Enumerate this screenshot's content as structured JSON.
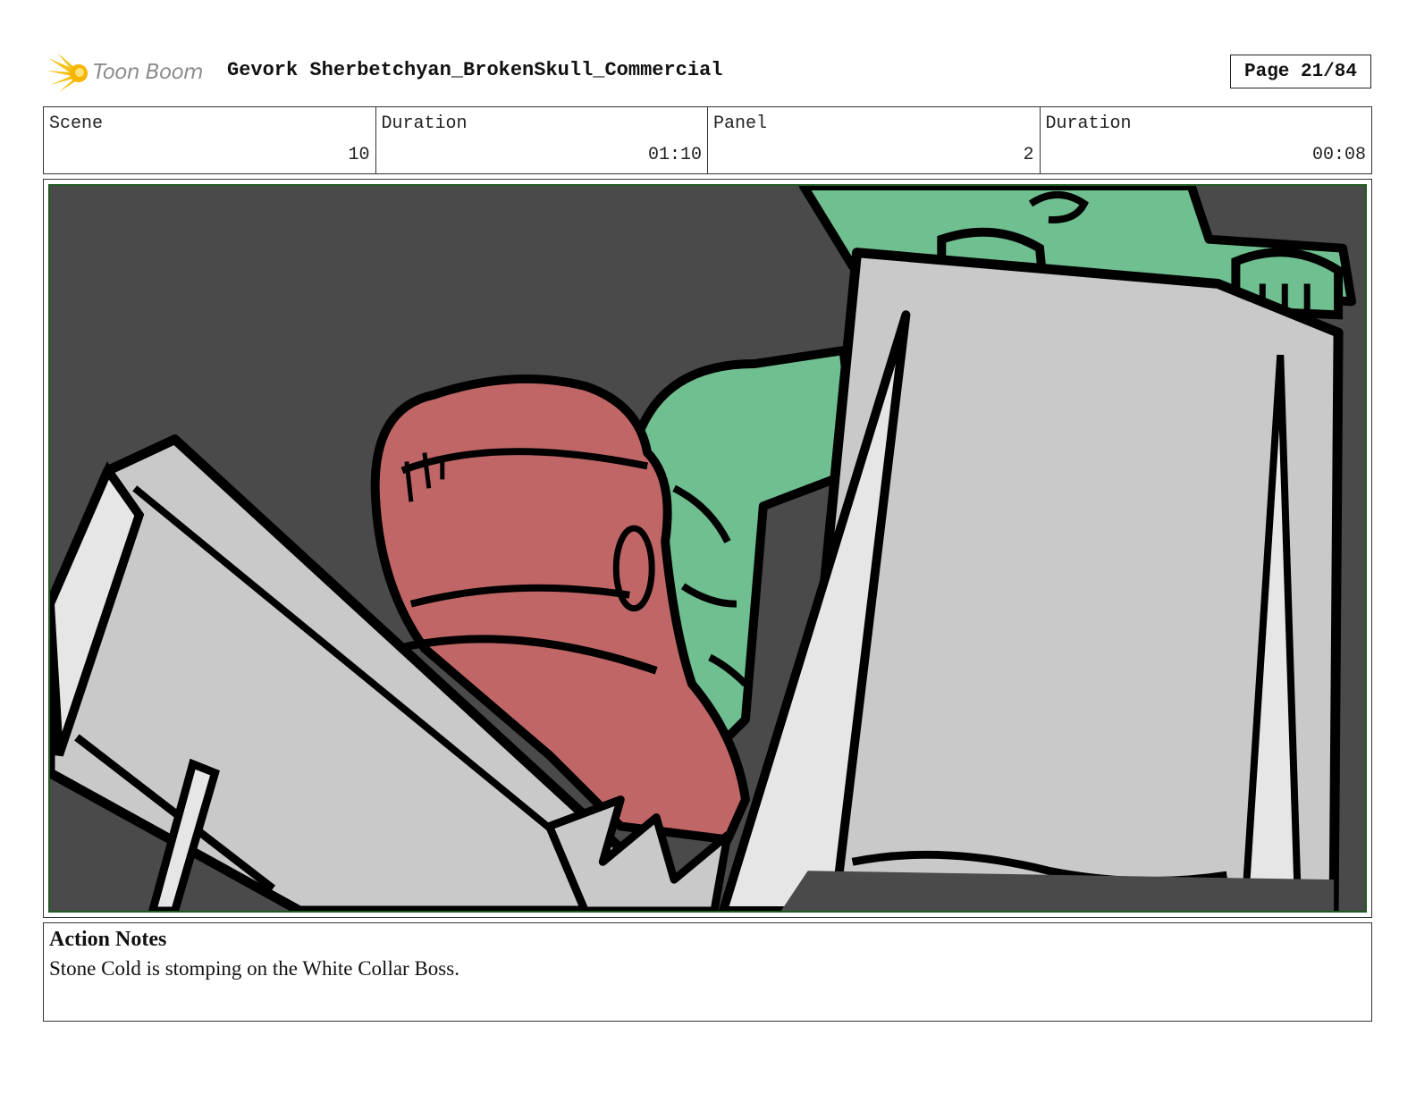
{
  "header": {
    "logo_text": "Toon Boom",
    "logo_icon": "toon-boom-starburst-icon",
    "project_title": "Gevork Sherbetchyan_BrokenSkull_Commercial",
    "page_label": "Page 21/84"
  },
  "info": [
    {
      "label": "Scene",
      "value": "10"
    },
    {
      "label": "Duration",
      "value": "01:10"
    },
    {
      "label": "Panel",
      "value": "2"
    },
    {
      "label": "Duration",
      "value": "00:08"
    }
  ],
  "panel": {
    "colors": {
      "background": "#4a4a4a",
      "ring_grey": "#c9c9c9",
      "ring_highlight": "#e6e6e6",
      "red_figure": "#c06666",
      "green_figure": "#6fbf90",
      "ink": "#000000",
      "frame_border": "#1f5a1f"
    }
  },
  "notes": {
    "title": "Action Notes",
    "text": "Stone Cold is stomping on the White Collar Boss."
  }
}
